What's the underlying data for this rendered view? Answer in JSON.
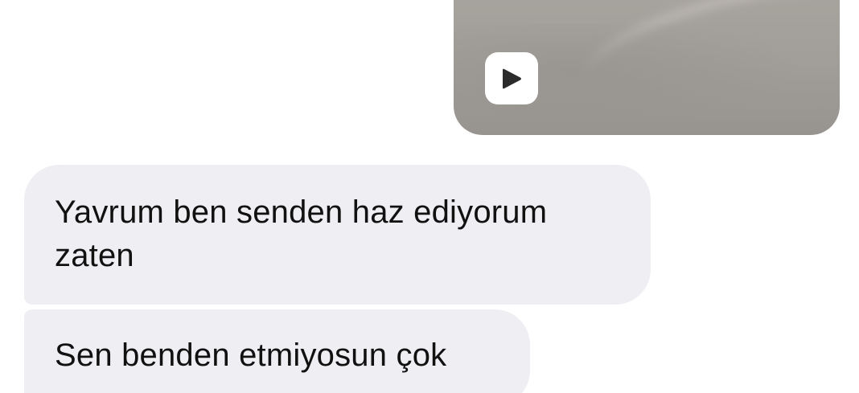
{
  "conversation": {
    "video_message": {
      "icon": "play-icon"
    },
    "messages": [
      {
        "text": "Yavrum ben senden haz ediyorum\nzaten"
      },
      {
        "text": "Sen benden etmiyosun çok"
      }
    ]
  },
  "colors": {
    "received_bubble": "#eeeef3",
    "text": "#111111",
    "background": "#ffffff"
  }
}
